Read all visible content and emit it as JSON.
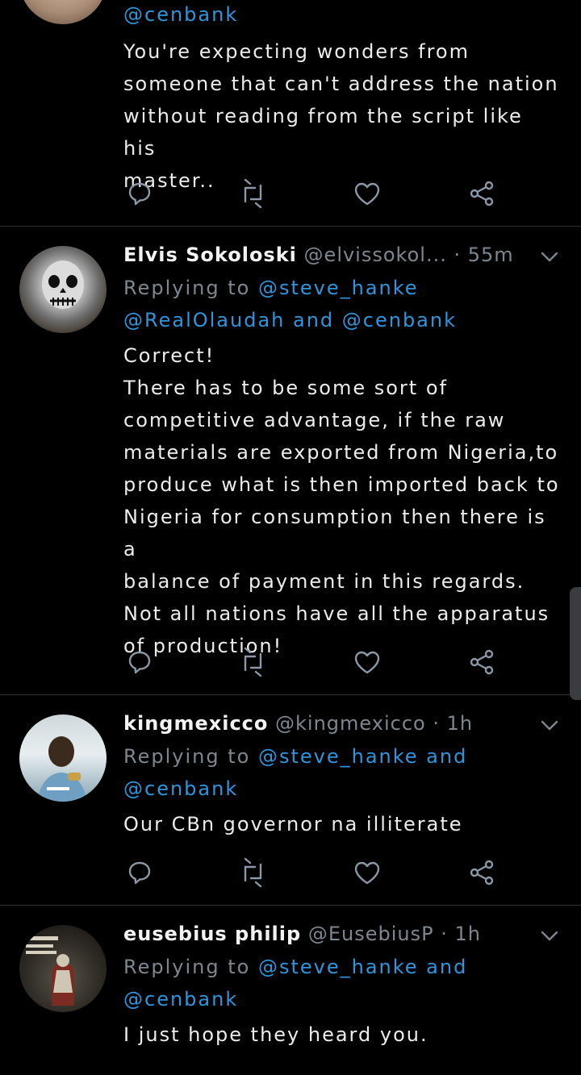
{
  "tweets": [
    {
      "reply_line_2": "@cenbank",
      "text": "You're expecting wonders from\nsomeone that can't address the nation\nwithout reading from the script like his\nmaster.."
    },
    {
      "name": "Elvis Sokoloski",
      "handle": "@elvissokol...",
      "time": "· 55m",
      "reply_prefix": "Replying to",
      "reply_line_1": "@steve_hanke",
      "reply_line_2": "@RealOlaudah and @cenbank",
      "text": "Correct!\nThere has to be some sort of\ncompetitive advantage, if the raw\nmaterials are exported from Nigeria,to\nproduce what is then imported back to\nNigeria for consumption then there is a\nbalance of payment in this regards.\nNot all nations have all the apparatus\nof production!"
    },
    {
      "name": "kingmexicco",
      "handle": "@kingmexicco",
      "time": "· 1h",
      "reply_prefix": "Replying to",
      "reply_line_1": "@steve_hanke and",
      "reply_line_2": "@cenbank",
      "text": "Our CBn governor na illiterate"
    },
    {
      "name": "eusebius philip",
      "handle": "@EusebiusP",
      "time": "· 1h",
      "reply_prefix": "Replying to",
      "reply_line_1": "@steve_hanke and",
      "reply_line_2": "@cenbank",
      "text": "I just hope they heard you."
    }
  ],
  "icons": {
    "reply": "reply-icon",
    "retweet": "retweet-icon",
    "like": "heart-icon",
    "share": "share-icon",
    "menu": "chevron-down-icon"
  },
  "colors": {
    "background": "#000000",
    "link": "#2f95dc",
    "muted": "#7d8790",
    "divider": "#2f3336"
  }
}
